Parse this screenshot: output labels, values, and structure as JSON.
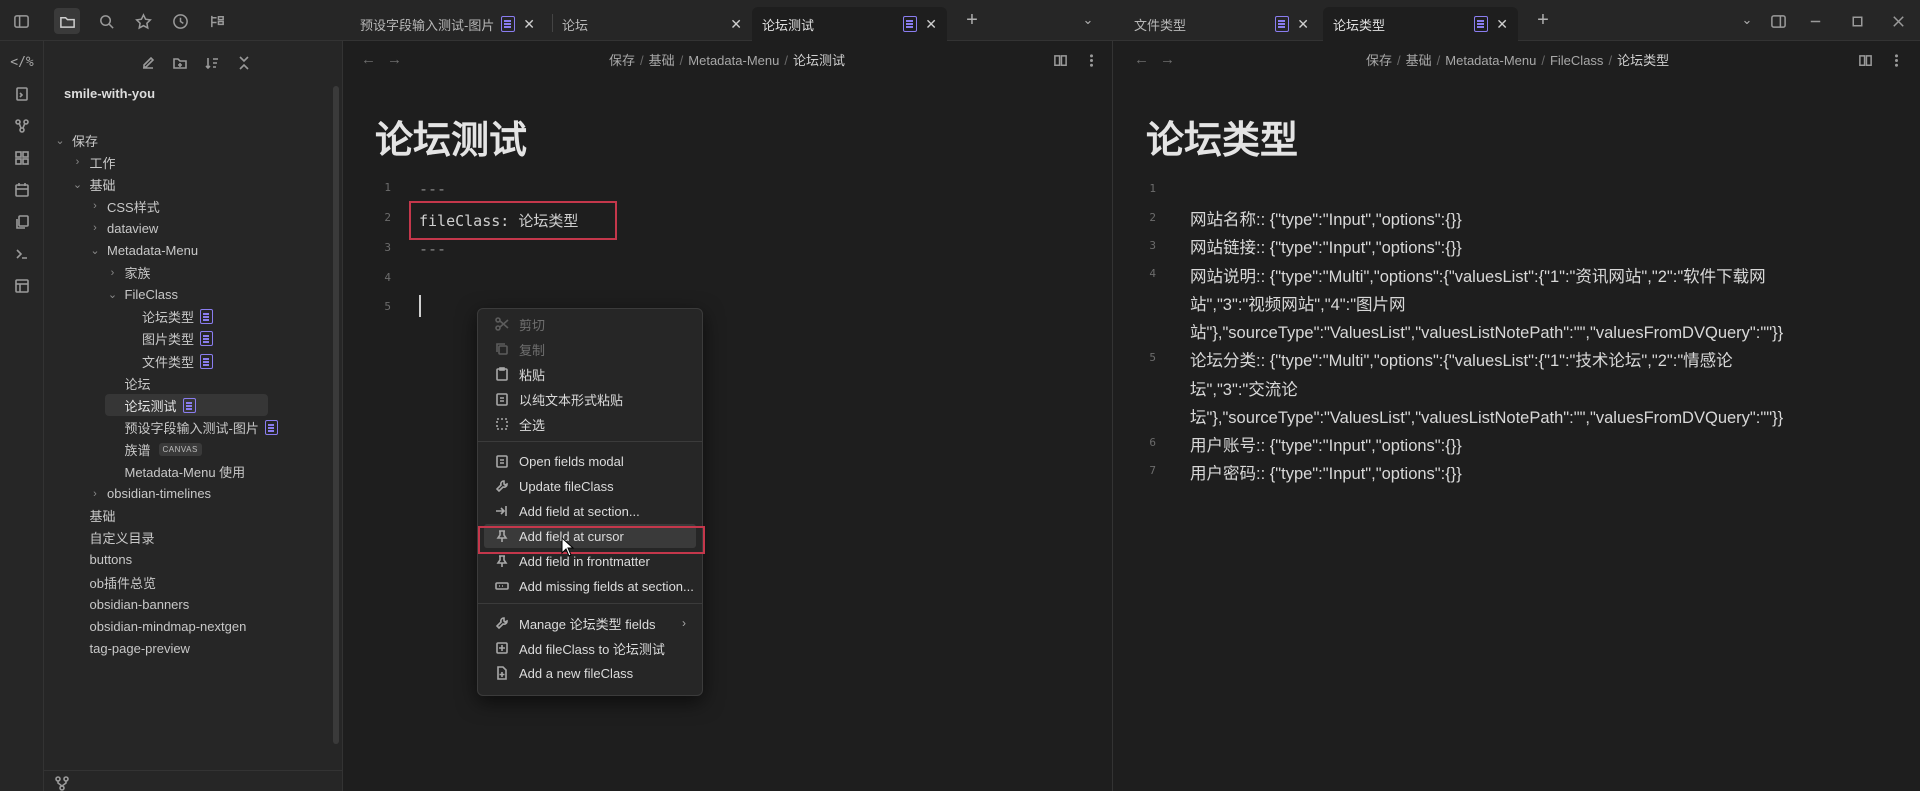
{
  "tabs_left": [
    {
      "label": "预设字段输入测试-图片",
      "active": false
    },
    {
      "label": "论坛",
      "active": false
    },
    {
      "label": "论坛测试",
      "active": true
    }
  ],
  "tabs_right": [
    {
      "label": "文件类型",
      "active": false
    },
    {
      "label": "论坛类型",
      "active": true
    }
  ],
  "sidebar": {
    "vault": "smile-with-you",
    "items": [
      {
        "label": "保存",
        "indent": 0
      },
      {
        "label": "工作",
        "indent": 1
      },
      {
        "label": "基础",
        "indent": 1
      },
      {
        "label": "CSS样式",
        "indent": 2
      },
      {
        "label": "dataview",
        "indent": 2
      },
      {
        "label": "Metadata-Menu",
        "indent": 2
      },
      {
        "label": "家族",
        "indent": 3
      },
      {
        "label": "FileClass",
        "indent": 3
      },
      {
        "label": "论坛类型",
        "indent": 4
      },
      {
        "label": "图片类型",
        "indent": 4
      },
      {
        "label": "文件类型",
        "indent": 4
      },
      {
        "label": "论坛",
        "indent": 3
      },
      {
        "label": "论坛测试",
        "indent": 3
      },
      {
        "label": "预设字段输入测试-图片",
        "indent": 3
      },
      {
        "label": "族谱",
        "indent": 3
      },
      {
        "label": "Metadata-Menu 使用",
        "indent": 3
      },
      {
        "label": "obsidian-timelines",
        "indent": 2
      },
      {
        "label": "基础",
        "indent": 1
      },
      {
        "label": "自定义目录",
        "indent": 1
      },
      {
        "label": "buttons",
        "indent": 1
      },
      {
        "label": "ob插件总览",
        "indent": 1
      },
      {
        "label": "obsidian-banners",
        "indent": 1
      },
      {
        "label": "obsidian-mindmap-nextgen",
        "indent": 1
      },
      {
        "label": "tag-page-preview",
        "indent": 1
      }
    ],
    "canvas_tag": "CANVAS"
  },
  "left_pane": {
    "breadcrumb": [
      "保存",
      "基础",
      "Metadata-Menu",
      "论坛测试"
    ],
    "title": "论坛测试",
    "lines": [
      {
        "num": "1",
        "text": "---"
      },
      {
        "num": "2",
        "text": "fileClass: 论坛类型"
      },
      {
        "num": "3",
        "text": "---"
      },
      {
        "num": "4",
        "text": ""
      },
      {
        "num": "5",
        "text": ""
      }
    ]
  },
  "right_pane": {
    "breadcrumb": [
      "保存",
      "基础",
      "Metadata-Menu",
      "FileClass",
      "论坛类型"
    ],
    "title": "论坛类型",
    "line_numbers": [
      "1",
      "2",
      "3",
      "4",
      "5",
      "6",
      "7"
    ],
    "text_lines": [
      "网站名称:: {\"type\":\"Input\",\"options\":{}}",
      "网站链接:: {\"type\":\"Input\",\"options\":{}}",
      "网站说明:: {\"type\":\"Multi\",\"options\":{\"valuesList\":{\"1\":\"资讯网站\",\"2\":\"软件下载网",
      "站\",\"3\":\"视频网站\",\"4\":\"图片网",
      "站\"},\"sourceType\":\"ValuesList\",\"valuesListNotePath\":\"\",\"valuesFromDVQuery\":\"\"}}",
      "论坛分类:: {\"type\":\"Multi\",\"options\":{\"valuesList\":{\"1\":\"技术论坛\",\"2\":\"情感论",
      "坛\",\"3\":\"交流论",
      "坛\"},\"sourceType\":\"ValuesList\",\"valuesListNotePath\":\"\",\"valuesFromDVQuery\":\"\"}}",
      "用户账号:: {\"type\":\"Input\",\"options\":{}}",
      "用户密码:: {\"type\":\"Input\",\"options\":{}}"
    ]
  },
  "context_menu": {
    "items": [
      {
        "label": "剪切",
        "icon": "scissors-icon",
        "disabled": true
      },
      {
        "label": "复制",
        "icon": "copy-icon",
        "disabled": true
      },
      {
        "label": "粘贴",
        "icon": "clipboard-icon",
        "disabled": false
      },
      {
        "label": "以纯文本形式粘贴",
        "icon": "clipboard-text-icon",
        "disabled": false
      },
      {
        "label": "全选",
        "icon": "select-all-icon",
        "disabled": false
      },
      {
        "label": "Open fields modal",
        "icon": "clipboard-list-icon",
        "disabled": false
      },
      {
        "label": "Update fileClass",
        "icon": "wrench-icon",
        "disabled": false
      },
      {
        "label": "Add field at section...",
        "icon": "arrow-into-icon",
        "disabled": false
      },
      {
        "label": "Add field at cursor",
        "icon": "pin-icon",
        "disabled": false,
        "highlighted": true
      },
      {
        "label": "Add field in frontmatter",
        "icon": "pin-icon",
        "disabled": false
      },
      {
        "label": "Add missing fields at section...",
        "icon": "input-icon",
        "disabled": false
      },
      {
        "label": "Manage 论坛类型 fields",
        "icon": "wrench-icon",
        "disabled": false,
        "submenu": true
      },
      {
        "label": "Add fileClass to 论坛测试",
        "icon": "plus-square-icon",
        "disabled": false
      },
      {
        "label": "Add a new fileClass",
        "icon": "file-plus-icon",
        "disabled": false
      }
    ]
  },
  "colors": {
    "accent": "#8a7df0",
    "highlight_box": "#c4374b"
  }
}
